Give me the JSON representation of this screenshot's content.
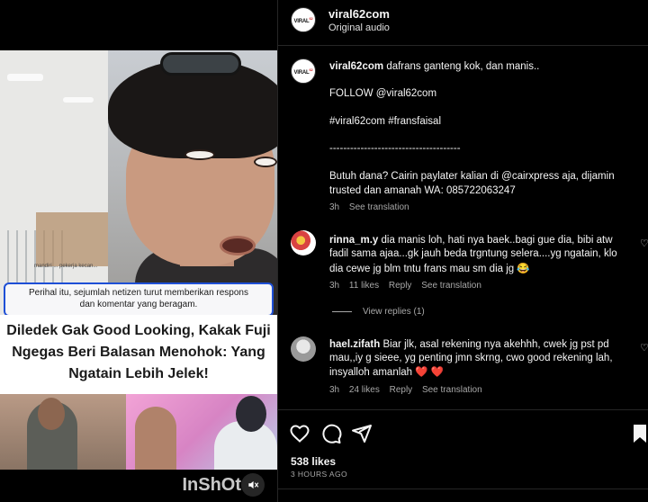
{
  "post": {
    "username": "viral62com",
    "audio": "Original audio",
    "avatar_logo": "VIRAL62",
    "likes": "538 likes",
    "time_ago": "3 HOURS AGO"
  },
  "caption": {
    "username": "viral62com",
    "text": "dafrans ganteng kok, dan manis..",
    "follow": "FOLLOW @viral62com",
    "hashtags": "#viral62com #fransfaisal",
    "divider": "--------------------------------------",
    "promo_line1": "Butuh dana? Cairin paylater kalian di @cairxpress aja, dijamin",
    "promo_line2": "trusted dan amanah WA: 085722063247",
    "time": "3h",
    "see_translation": "See translation"
  },
  "comments": [
    {
      "username": "rinna_m.y",
      "line1": "dia manis loh, hati nya baek..bagi gue dia, bibi atw",
      "line2": "fadil sama ajaa...gk jauh beda trgntung selera....yg ngatain, klo",
      "line3": "dia cewe jg blm tntu frans mau sm dia jg 😂",
      "time": "3h",
      "likes": "11 likes",
      "reply": "Reply",
      "see_translation": "See translation",
      "view_replies": "View replies (1)"
    },
    {
      "username": "hael.zifath",
      "line1": "Biar jlk, asal rekening nya akehhh, cwek jg pst pd",
      "line2": "mau,,iy g sieee, yg penting jmn skrng, cwo good rekening lah,",
      "line3": "insyalloh amanlah ❤️ ❤️",
      "time": "3h",
      "likes": "24 likes",
      "reply": "Reply",
      "see_translation": "See translation"
    }
  ],
  "media": {
    "caption_overlay_line1": "Perihal itu, sejumlah netizen turut memberikan respons",
    "caption_overlay_line2": "dan komentar yang beragam.",
    "small_name": "mandiri ... pekerja kecan...",
    "headline_line1": "Diledek Gak Good Looking, Kakak Fuji",
    "headline_line2": "Ngegas Beri Balasan Menohok: Yang",
    "headline_line3": "Ngatain Lebih Jelek!",
    "watermark": "InShOt"
  },
  "colors": {
    "background": "#000000",
    "text_primary": "#f5f5f5",
    "text_secondary": "#a8a8a8",
    "divider": "#262626",
    "headline_bg": "#ffffff",
    "overlay_border": "#1e4fd6",
    "heart_red": "#ed4956"
  },
  "icons": {
    "like": "heart-outline-icon",
    "comment": "comment-bubble-icon",
    "share": "paper-plane-icon",
    "save": "bookmark-icon",
    "mute": "speaker-muted-icon"
  }
}
